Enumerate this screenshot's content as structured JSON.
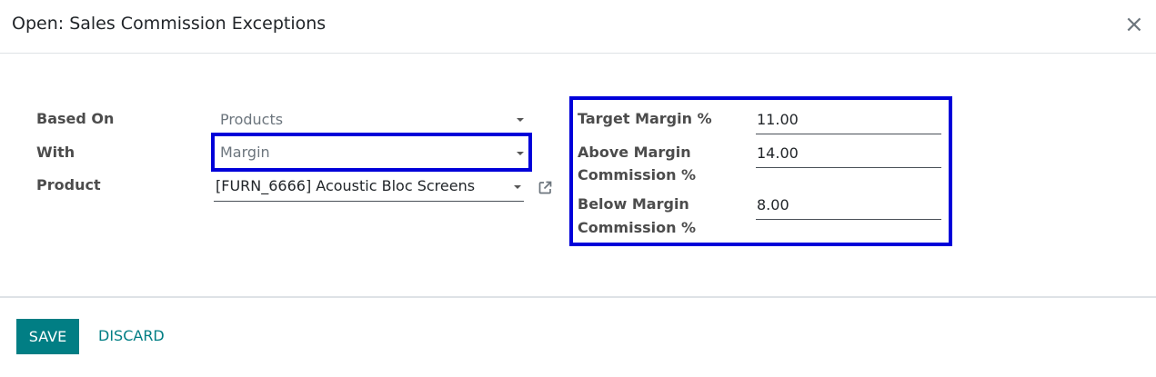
{
  "dialog": {
    "title": "Open: Sales Commission Exceptions",
    "close_label": "×"
  },
  "form": {
    "based_on": {
      "label": "Based On",
      "value": "Products"
    },
    "with": {
      "label": "With",
      "value": "Margin"
    },
    "product": {
      "label": "Product",
      "value": "[FURN_6666] Acoustic Bloc Screens"
    },
    "target_margin": {
      "label": "Target Margin %",
      "value": "11.00"
    },
    "above_margin": {
      "label_line1": "Above Margin",
      "label_line2": "Commission %",
      "value": "14.00"
    },
    "below_margin": {
      "label_line1": "Below Margin",
      "label_line2": "Commission %",
      "value": "8.00"
    }
  },
  "footer": {
    "save_label": "SAVE",
    "discard_label": "DISCARD"
  },
  "colors": {
    "primary": "#017e84",
    "highlight": "#0000d9"
  }
}
